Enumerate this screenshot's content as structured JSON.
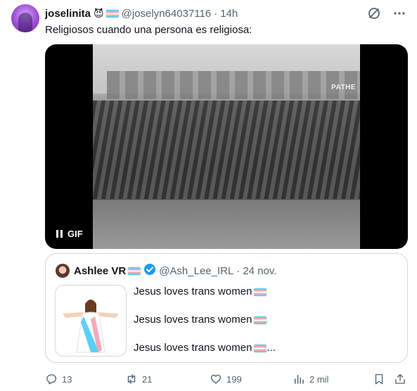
{
  "tweet": {
    "display_name": "joselinita",
    "handle": "@joselyn64037116",
    "separator": "·",
    "time": "14h",
    "name_emoji": "😈",
    "text": "Religiosos cuando una persona es religiosa:"
  },
  "media": {
    "type_label": "GIF",
    "watermark": "PATHE"
  },
  "quote": {
    "display_name": "Ashlee VR",
    "handle": "@Ash_Lee_IRL",
    "separator": "·",
    "date": "24 nov.",
    "lines": [
      "Jesus loves trans women",
      "Jesus loves trans women",
      "Jesus loves trans women"
    ],
    "ellipsis": "..."
  },
  "actions": {
    "replies": "13",
    "reposts": "21",
    "likes": "199",
    "views": "2 mil"
  },
  "colors": {
    "text": "#0f1419",
    "muted": "#536471",
    "border": "#cfd9de",
    "verified": "#1d9bf0",
    "trans_blue": "#5bcefa",
    "trans_pink": "#f5a9b8"
  },
  "icons": [
    "grok-icon",
    "more-icon",
    "verified-icon",
    "reply-icon",
    "repost-icon",
    "like-icon",
    "views-icon",
    "bookmark-icon",
    "share-icon"
  ]
}
